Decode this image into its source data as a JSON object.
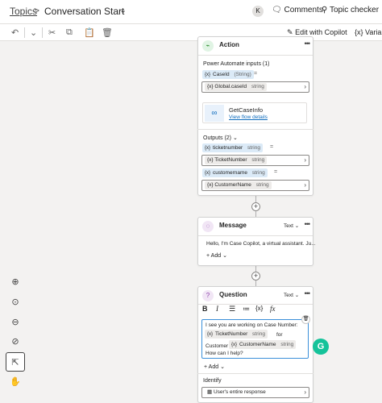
{
  "header": {
    "breadcrumb_root": "Topics",
    "breadcrumb_sep": ">",
    "topic_title": "Conversation Start",
    "avatar_initial": "K",
    "comments_label": "Comments",
    "topic_checker_label": "Topic checker"
  },
  "toolbar": {
    "edit_with_copilot_label": "Edit with Copilot",
    "variables_label": "Variab"
  },
  "action_card": {
    "title": "Action",
    "inputs_heading": "Power Automate inputs (1)",
    "input_var_name": "CaseId",
    "input_var_type": "(String)",
    "input_value_name": "Global.caseId",
    "input_value_type": "string",
    "flow_name": "GetCaseInfo",
    "view_flow_link": "View flow details",
    "outputs_heading": "Outputs (2)",
    "outputs": [
      {
        "name": "ticketnumber",
        "type": "string",
        "target": "TicketNumber",
        "target_type": "string"
      },
      {
        "name": "customername",
        "type": "string",
        "target": "CustomerName",
        "target_type": "string"
      }
    ]
  },
  "message_card": {
    "title": "Message",
    "mode": "Text",
    "text": "Hello, I'm Case Copilot, a virtual assistant. Ju...",
    "add_label": "Add"
  },
  "question_card": {
    "title": "Question",
    "mode": "Text",
    "line1": "I see you are working on Case Number:",
    "var1": "TicketNumber",
    "var1_type": "string",
    "word_for": "for",
    "word_customer": "Customer",
    "var2": "CustomerName",
    "var2_type": "string",
    "line3": "How can I help?",
    "add_label": "Add",
    "identify_label": "Identify",
    "identify_value": "User's entire response"
  },
  "grammarly_letter": "G"
}
